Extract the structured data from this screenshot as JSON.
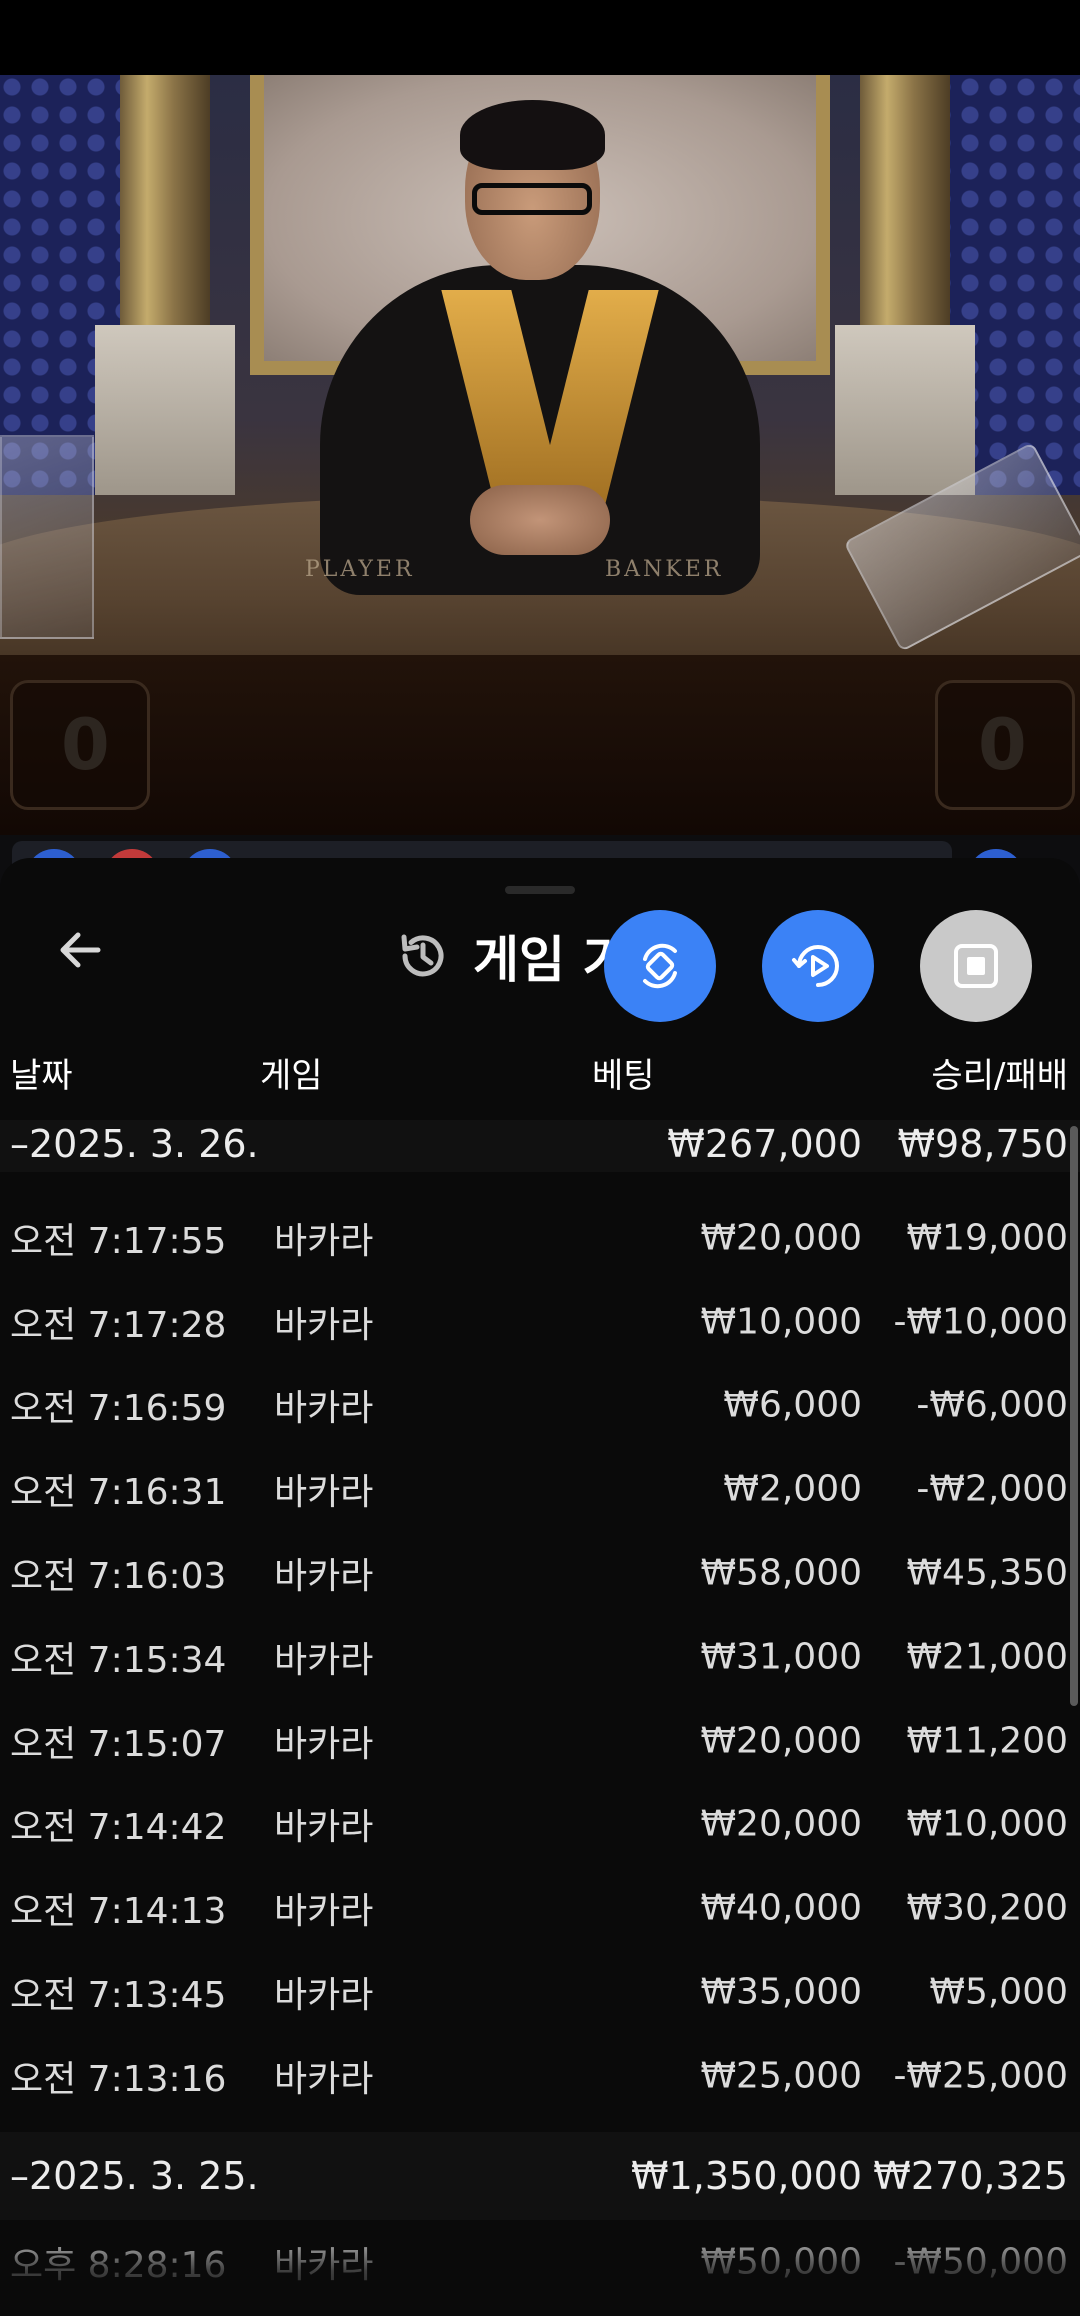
{
  "video": {
    "table_label_player": "PLAYER",
    "table_label_banker": "BANKER",
    "player_score": "0",
    "banker_score": "0"
  },
  "sheet": {
    "title": "게임 기록",
    "back_icon": "arrow-left-icon",
    "title_icon": "history-icon",
    "actions": [
      {
        "icon": "rotate-device-icon",
        "color": "#3b82f6"
      },
      {
        "icon": "replay-play-icon",
        "color": "#3b82f6"
      },
      {
        "icon": "stop-square-icon",
        "color": "#c9c9c9"
      }
    ]
  },
  "columns": {
    "date": "날짜",
    "game": "게임",
    "bet": "베팅",
    "result": "승리/패배"
  },
  "groups": [
    {
      "date": "–2025. 3. 26.",
      "bet_total": "₩267,000",
      "result_total": "₩98,750",
      "rows": [
        {
          "time": "오전 7:17:55",
          "game": "바카라",
          "bet": "₩20,000",
          "result": "₩19,000"
        },
        {
          "time": "오전 7:17:28",
          "game": "바카라",
          "bet": "₩10,000",
          "result": "-₩10,000"
        },
        {
          "time": "오전 7:16:59",
          "game": "바카라",
          "bet": "₩6,000",
          "result": "-₩6,000"
        },
        {
          "time": "오전 7:16:31",
          "game": "바카라",
          "bet": "₩2,000",
          "result": "-₩2,000"
        },
        {
          "time": "오전 7:16:03",
          "game": "바카라",
          "bet": "₩58,000",
          "result": "₩45,350"
        },
        {
          "time": "오전 7:15:34",
          "game": "바카라",
          "bet": "₩31,000",
          "result": "₩21,000"
        },
        {
          "time": "오전 7:15:07",
          "game": "바카라",
          "bet": "₩20,000",
          "result": "₩11,200"
        },
        {
          "time": "오전 7:14:42",
          "game": "바카라",
          "bet": "₩20,000",
          "result": "₩10,000"
        },
        {
          "time": "오전 7:14:13",
          "game": "바카라",
          "bet": "₩40,000",
          "result": "₩30,200"
        },
        {
          "time": "오전 7:13:45",
          "game": "바카라",
          "bet": "₩35,000",
          "result": "₩5,000"
        },
        {
          "time": "오전 7:13:16",
          "game": "바카라",
          "bet": "₩25,000",
          "result": "-₩25,000"
        }
      ]
    },
    {
      "date": "–2025. 3. 25.",
      "bet_total": "₩1,350,000",
      "result_total": "₩270,325",
      "rows": [
        {
          "time": "오후 8:28:16",
          "game": "바카라",
          "bet": "₩50,000",
          "result": "-₩50,000"
        }
      ]
    }
  ]
}
